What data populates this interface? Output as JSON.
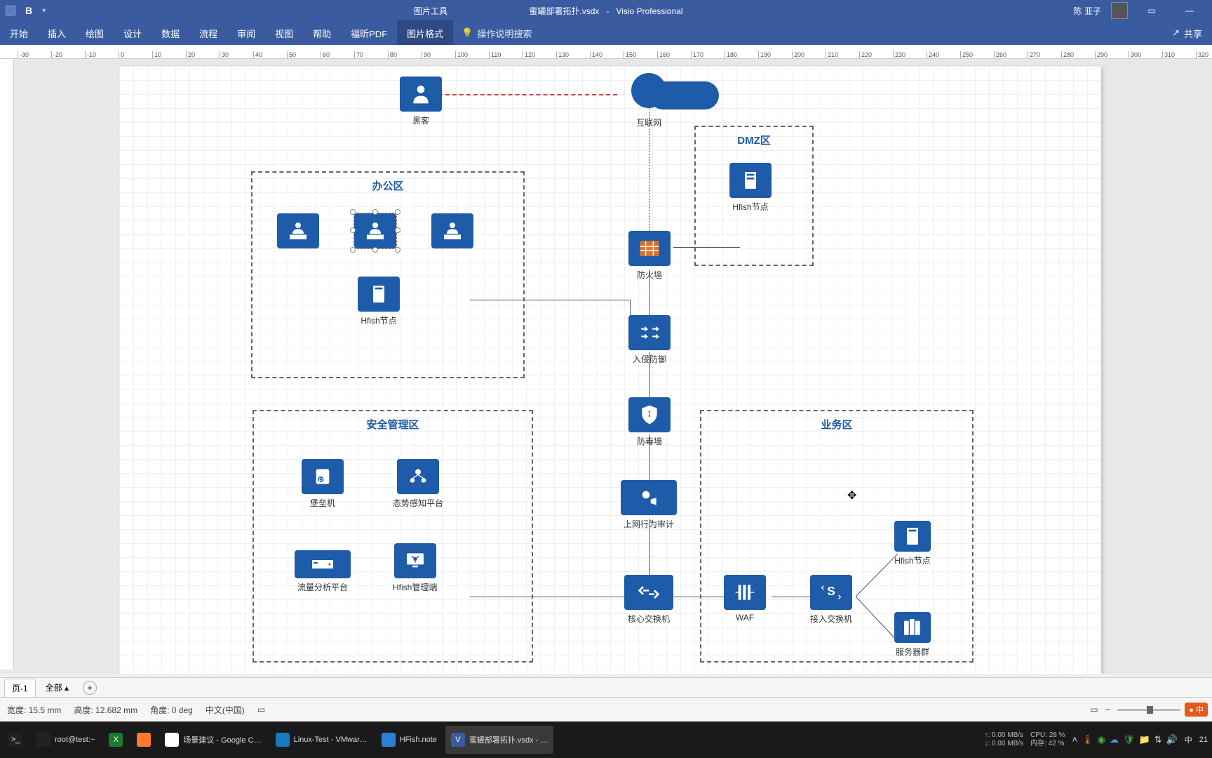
{
  "title_bar": {
    "context_tool": "图片工具",
    "file_name": "蜜罐部署拓扑.vsdx",
    "app_name": "Visio Professional",
    "separator": "-",
    "user_name": "陈 亚子",
    "bold_btn": "B"
  },
  "ribbon": {
    "tabs": [
      "开始",
      "插入",
      "绘图",
      "设计",
      "数据",
      "流程",
      "审阅",
      "视图",
      "帮助",
      "福昕PDF",
      "图片格式"
    ],
    "active_index": 10,
    "tell_me": "操作说明搜索",
    "share": "共享"
  },
  "ruler": {
    "ticks": [
      "-30",
      "-20",
      "-10",
      "0",
      "10",
      "20",
      "30",
      "40",
      "50",
      "60",
      "70",
      "80",
      "90",
      "100",
      "110",
      "120",
      "130",
      "140",
      "150",
      "160",
      "170",
      "180",
      "190",
      "200",
      "210",
      "220",
      "230",
      "240",
      "250",
      "260",
      "270",
      "280",
      "290",
      "300",
      "310",
      "320"
    ]
  },
  "diagram": {
    "zones": {
      "office": "办公区",
      "dmz": "DMZ区",
      "security": "安全管理区",
      "business": "业务区"
    },
    "nodes": {
      "hacker": "黑客",
      "internet": "互联网",
      "firewall": "防火墙",
      "ips": "入侵防御",
      "av_wall": "防毒墙",
      "behavior_audit": "上网行为审计",
      "core_switch": "核心交换机",
      "hfish_node": "Hfish节点",
      "bastion": "堡垒机",
      "sa_platform": "态势感知平台",
      "traffic_platform": "流量分析平台",
      "hfish_mgmt": "Hfish管理端",
      "waf": "WAF",
      "access_switch": "接入交换机",
      "servers": "服务器群"
    }
  },
  "page_tabs": {
    "page1": "页-1",
    "all": "全部",
    "add": "+"
  },
  "status": {
    "width_lbl": "宽度:",
    "width_val": "15.5 mm",
    "height_lbl": "高度:",
    "height_val": "12.682 mm",
    "angle_lbl": "角度:",
    "angle_val": "0 deg",
    "lang": "中文(中国)",
    "lang_ind": "中"
  },
  "taskbar": {
    "items": [
      {
        "icon_bg": "#222",
        "icon_txt": ">_",
        "label": "",
        "active": false
      },
      {
        "icon_bg": "#222",
        "icon_txt": "",
        "label": "root@test:~",
        "active": false,
        "icon_svg": "terminal"
      },
      {
        "icon_bg": "#1a782f",
        "icon_txt": "X",
        "label": "",
        "active": false
      },
      {
        "icon_bg": "#ff7b29",
        "icon_txt": "",
        "label": "",
        "active": false,
        "icon_svg": "firefox"
      },
      {
        "icon_bg": "#fff",
        "icon_txt": "",
        "label": "场景建议 - Google C…",
        "active": false,
        "icon_svg": "chrome"
      },
      {
        "icon_bg": "#187abf",
        "icon_txt": "",
        "label": "Linux-Test - VMwar…",
        "active": false,
        "icon_svg": "vmware"
      },
      {
        "icon_bg": "#2b7fd4",
        "icon_txt": "",
        "label": "HFish.note",
        "active": false,
        "icon_svg": "note"
      },
      {
        "icon_bg": "#3a5ba0",
        "icon_txt": "V",
        "label": "蜜罐部署拓扑.vsdx - …",
        "active": true
      }
    ],
    "perf": {
      "up": "↑: 0.00 MB/s",
      "down": "↓: 0.00 MB/s",
      "cpu": "CPU: 28 %",
      "mem": "内存: 42 %"
    },
    "clock": "21"
  }
}
